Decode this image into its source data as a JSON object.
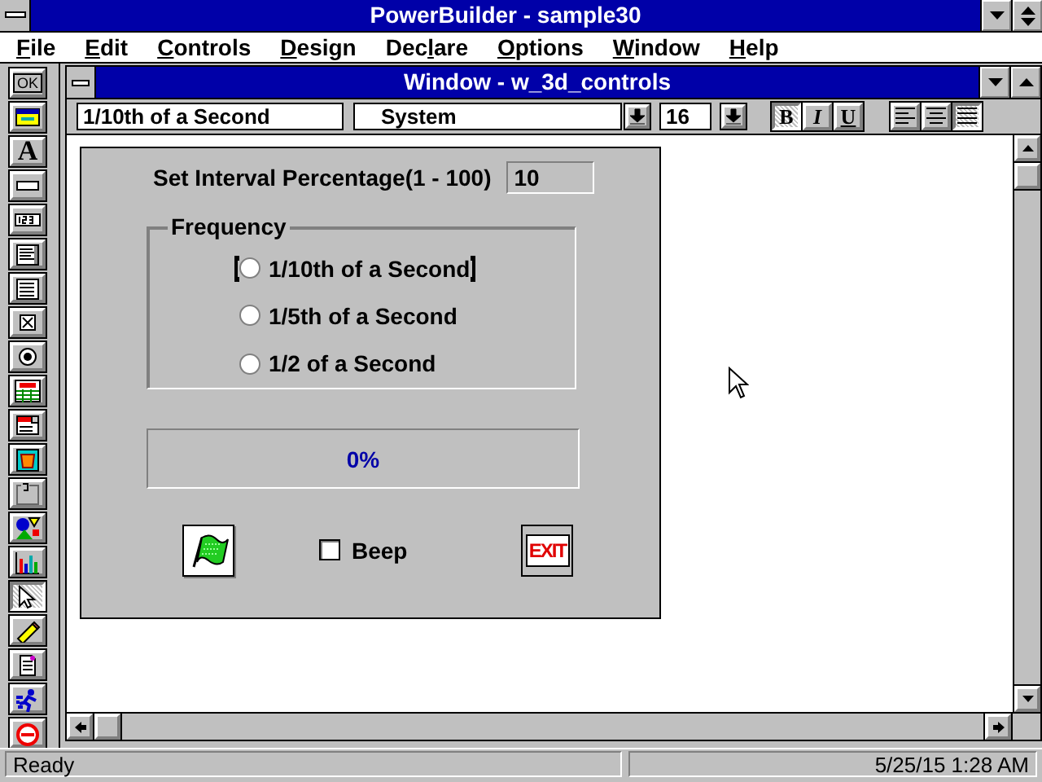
{
  "app": {
    "title": "PowerBuilder - sample30"
  },
  "menu": [
    {
      "key": "F",
      "after": "ile"
    },
    {
      "key": "E",
      "after": "dit"
    },
    {
      "key": "C",
      "after": "ontrols"
    },
    {
      "key": "D",
      "after": "esign"
    },
    {
      "before": "Dec",
      "key": "l",
      "after": "are"
    },
    {
      "key": "O",
      "after": "ptions"
    },
    {
      "key": "W",
      "after": "indow"
    },
    {
      "key": "H",
      "after": "elp"
    }
  ],
  "tools": [
    {
      "kind": "ok",
      "label": "OK",
      "selected": false
    },
    {
      "kind": "window",
      "selected": false
    },
    {
      "kind": "text",
      "label": "A",
      "selected": false
    },
    {
      "kind": "singleline",
      "selected": false
    },
    {
      "kind": "edit",
      "selected": false
    },
    {
      "kind": "multiline",
      "selected": false
    },
    {
      "kind": "listbox",
      "selected": false
    },
    {
      "kind": "checkbox",
      "selected": false
    },
    {
      "kind": "radio",
      "selected": false
    },
    {
      "kind": "datawindow",
      "selected": false
    },
    {
      "kind": "dropdown",
      "selected": false
    },
    {
      "kind": "picture",
      "selected": false
    },
    {
      "kind": "groupbox",
      "selected": false
    },
    {
      "kind": "shapes",
      "selected": false
    },
    {
      "kind": "graph",
      "selected": false
    },
    {
      "kind": "pointer",
      "selected": true
    },
    {
      "kind": "eraser",
      "selected": false
    },
    {
      "kind": "script",
      "selected": false
    },
    {
      "kind": "run",
      "selected": false
    },
    {
      "kind": "debug",
      "selected": false
    }
  ],
  "child_window": {
    "title": "Window - w_3d_controls"
  },
  "style_bar": {
    "text_field": "1/10th of a Second",
    "font_face": "System",
    "font_size": "16",
    "text_styles": [
      {
        "kind": "bold",
        "label": "B",
        "pressed": true
      },
      {
        "kind": "italic",
        "label": "I",
        "pressed": false
      },
      {
        "kind": "underline",
        "label": "U",
        "pressed": false
      }
    ],
    "alignment": [
      {
        "kind": "left",
        "pressed": false
      },
      {
        "kind": "center",
        "pressed": false
      },
      {
        "kind": "justify",
        "pressed": true
      }
    ]
  },
  "form": {
    "interval_label": "Set Interval Percentage(1 - 100)",
    "interval_value": "10",
    "group_caption": "Frequency",
    "radios": [
      {
        "label": "1/10th of a Second",
        "selected": false,
        "handles": true
      },
      {
        "label": "1/5th of a Second",
        "selected": false,
        "handles": false
      },
      {
        "label": "1/2 of a Second",
        "selected": false,
        "handles": false
      }
    ],
    "progress": {
      "level": 0,
      "text": "0%"
    },
    "beep": {
      "label": "Beep",
      "checked": false
    },
    "exit_button": {
      "label": "EXIT"
    }
  },
  "status_bar": {
    "message": "Ready",
    "datetime": "5/25/15  1:28 AM"
  }
}
